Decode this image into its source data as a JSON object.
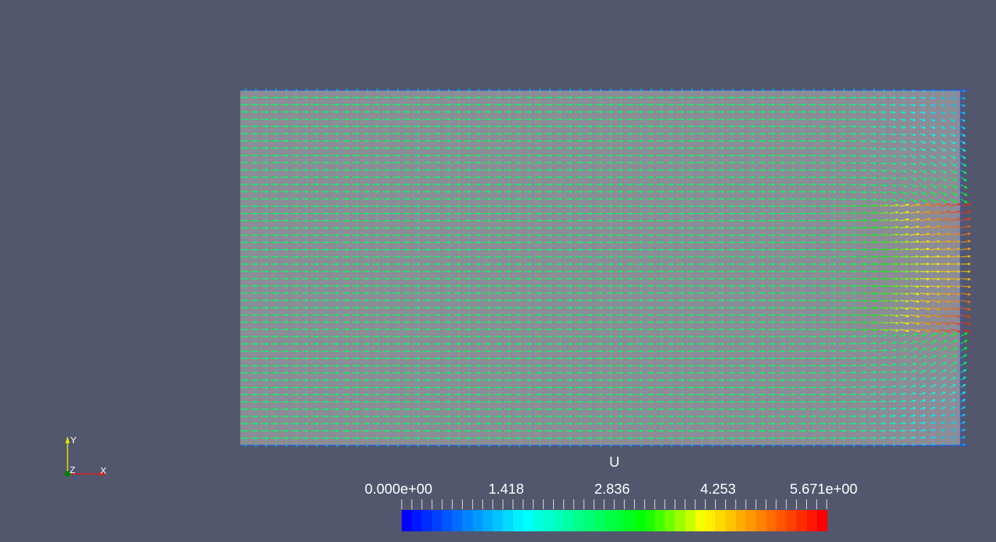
{
  "view": {
    "background": "#52576e",
    "domain_fill": "#8c8c96",
    "domain_border": "#1a4dff"
  },
  "field": {
    "variable": "U",
    "glyph": "arrow-icon",
    "columns": 72,
    "rows": 50,
    "colormap": [
      "#0000ff",
      "#0080ff",
      "#00ffff",
      "#00ff80",
      "#00ff00",
      "#ffff00",
      "#ff8000",
      "#ff0000"
    ],
    "range": [
      0,
      5.671
    ]
  },
  "colorbar": {
    "title": "U",
    "ticks": [
      "0.000e+00",
      "1.418",
      "2.836",
      "4.253",
      "5.671e+00"
    ],
    "segments": 42
  },
  "axes": {
    "x": "X",
    "y": "Y",
    "z": "Z",
    "x_color": "#d71e1e",
    "y_color": "#e6e600",
    "z_color": "#008000"
  }
}
